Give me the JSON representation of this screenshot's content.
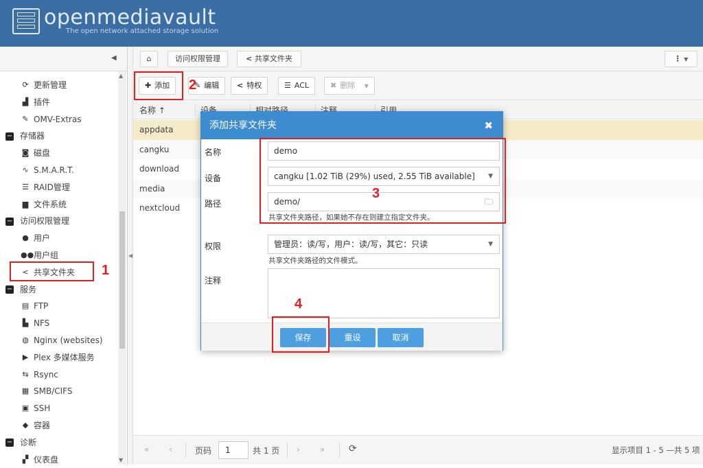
{
  "header": {
    "logo_title": "openmediavault",
    "logo_subtitle": "The open network attached storage solution"
  },
  "breadcrumb": {
    "items": [
      "访问权限管理",
      "共享文件夹"
    ]
  },
  "sidebar": {
    "items": [
      {
        "label": "更新管理",
        "icon": "refresh-icon",
        "level": "child"
      },
      {
        "label": "插件",
        "icon": "puzzle-icon",
        "level": "child"
      },
      {
        "label": "OMV-Extras",
        "icon": "tools-icon",
        "level": "child"
      },
      {
        "label": "存储器",
        "icon": "minus-square-icon",
        "level": "group"
      },
      {
        "label": "磁盘",
        "icon": "disk-icon",
        "level": "child"
      },
      {
        "label": "S.M.A.R.T.",
        "icon": "pulse-icon",
        "level": "child"
      },
      {
        "label": "RAID管理",
        "icon": "raid-icon",
        "level": "child"
      },
      {
        "label": "文件系统",
        "icon": "folder-icon",
        "level": "child"
      },
      {
        "label": "访问权限管理",
        "icon": "minus-square-icon",
        "level": "group"
      },
      {
        "label": "用户",
        "icon": "user-icon",
        "level": "child"
      },
      {
        "label": "用户组",
        "icon": "users-icon",
        "level": "child"
      },
      {
        "label": "共享文件夹",
        "icon": "share-icon",
        "level": "child"
      },
      {
        "label": "服务",
        "icon": "minus-square-icon",
        "level": "group"
      },
      {
        "label": "FTP",
        "icon": "ftp-icon",
        "level": "child"
      },
      {
        "label": "NFS",
        "icon": "nfs-icon",
        "level": "child"
      },
      {
        "label": "Nginx (websites)",
        "icon": "globe-icon",
        "level": "child"
      },
      {
        "label": "Plex 多媒体服务",
        "icon": "play-icon",
        "level": "child"
      },
      {
        "label": "Rsync",
        "icon": "rsync-icon",
        "level": "child"
      },
      {
        "label": "SMB/CIFS",
        "icon": "windows-icon",
        "level": "child"
      },
      {
        "label": "SSH",
        "icon": "terminal-icon",
        "level": "child"
      },
      {
        "label": "容器",
        "icon": "docker-icon",
        "level": "child"
      },
      {
        "label": "诊断",
        "icon": "minus-square-icon",
        "level": "group"
      },
      {
        "label": "仪表盘",
        "icon": "dashboard-icon",
        "level": "child"
      }
    ]
  },
  "toolbar": {
    "add_label": "添加",
    "edit_label": "编辑",
    "privileges_label": "特权",
    "acl_label": "ACL",
    "delete_label": "删除"
  },
  "grid": {
    "columns": [
      "名称",
      "设备",
      "相对路径",
      "注释",
      "引用"
    ],
    "rows": [
      "appdata",
      "cangku",
      "download",
      "media",
      "nextcloud"
    ]
  },
  "pager": {
    "page_label": "页码",
    "page_value": "1",
    "of_pages": "共 1 页",
    "display_info": "显示项目 1 - 5 —共 5 项"
  },
  "dialog": {
    "title": "添加共享文件夹",
    "name_label": "名称",
    "name_value": "demo",
    "device_label": "设备",
    "device_value": "cangku [1.02 TiB (29%) used, 2.55 TiB available]",
    "path_label": "路径",
    "path_value": "demo/",
    "path_help": "共享文件夹路径，如果她不存在则建立指定文件夹。",
    "perm_label": "权限",
    "perm_value": "管理员：读/写，用户：读/写，其它：只读",
    "perm_help": "共享文件夹路径的文件模式。",
    "comment_label": "注释",
    "save_label": "保存",
    "reset_label": "重设",
    "cancel_label": "取消"
  },
  "annotations": {
    "n1": "1",
    "n2": "2",
    "n3": "3",
    "n4": "4"
  },
  "colors": {
    "header": "#3a6ea5",
    "dialog_header": "#3d8ccf",
    "button": "#4d9fe0",
    "selected_row": "#f5ebc9",
    "annotation": "#e02020"
  }
}
